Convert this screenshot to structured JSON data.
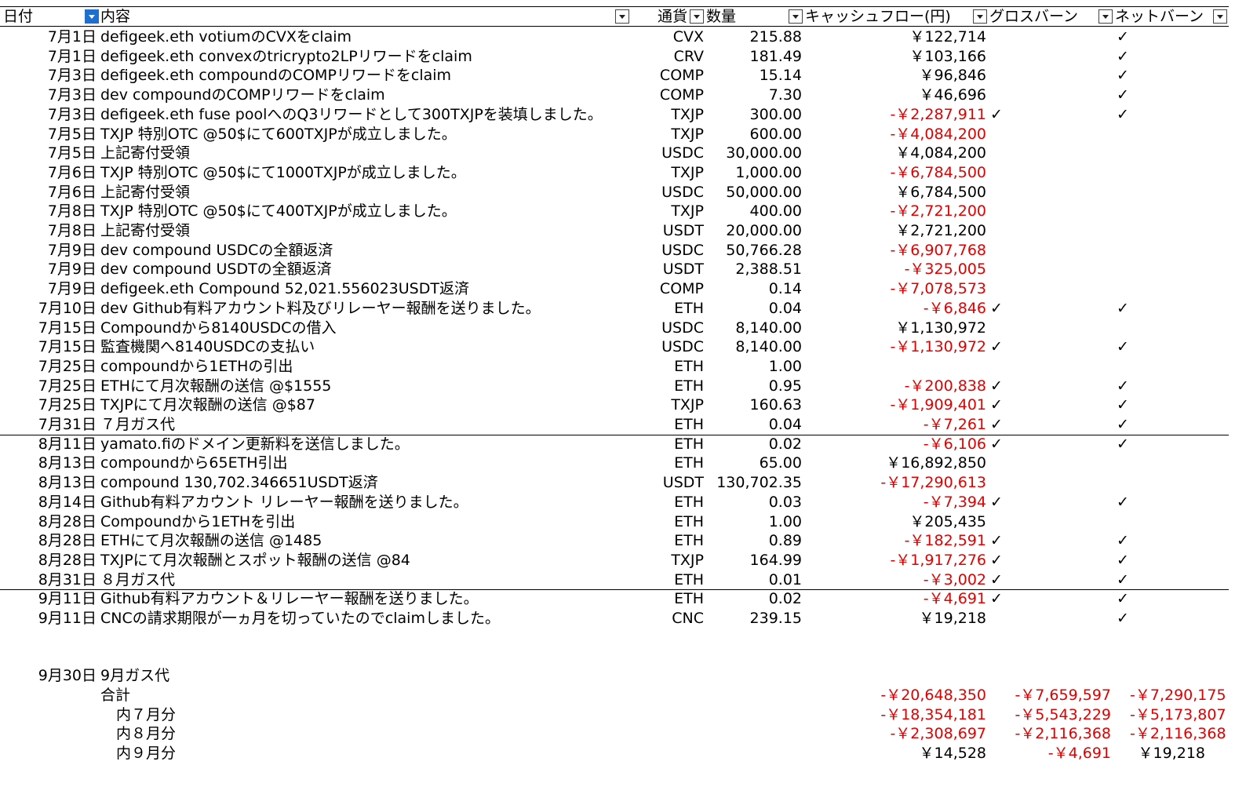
{
  "headers": {
    "date": "日付",
    "content": "内容",
    "currency": "通貨",
    "quantity": "数量",
    "cashflow": "キャッシュフロー(円)",
    "gross_burn": "グロスバーン",
    "net_burn": "ネットバーン"
  },
  "rows": [
    {
      "date": "7月1日",
      "desc": "defigeek.eth  votiumのCVXをclaim",
      "cur": "CVX",
      "qty": "215.88",
      "cf": "￥122,714",
      "neg": false,
      "gb": "",
      "nb": "✓"
    },
    {
      "date": "7月1日",
      "desc": "defigeek.eth  convexのtricrypto2LPリワードをclaim",
      "cur": "CRV",
      "qty": "181.49",
      "cf": "￥103,166",
      "neg": false,
      "gb": "",
      "nb": "✓"
    },
    {
      "date": "7月3日",
      "desc": "defigeek.eth   compoundのCOMPリワードをclaim",
      "cur": "COMP",
      "qty": "15.14",
      "cf": "￥96,846",
      "neg": false,
      "gb": "",
      "nb": "✓"
    },
    {
      "date": "7月3日",
      "desc": "dev   compoundのCOMPリワードをclaim",
      "cur": "COMP",
      "qty": "7.30",
      "cf": "￥46,696",
      "neg": false,
      "gb": "",
      "nb": "✓"
    },
    {
      "date": "7月3日",
      "desc": "defigeek.eth   fuse poolへのQ3リワードとして300TXJPを装填しました。",
      "cur": "TXJP",
      "qty": "300.00",
      "cf": "-￥2,287,911",
      "neg": true,
      "gb": "✓",
      "nb": "✓"
    },
    {
      "date": "7月5日",
      "desc": "TXJP 特別OTC    @50$にて600TXJPが成立しました。",
      "cur": "TXJP",
      "qty": "600.00",
      "cf": "-￥4,084,200",
      "neg": true,
      "gb": "",
      "nb": ""
    },
    {
      "date": "7月5日",
      "desc": "上記寄付受領",
      "cur": "USDC",
      "qty": "30,000.00",
      "cf": "￥4,084,200",
      "neg": false,
      "gb": "",
      "nb": ""
    },
    {
      "date": "7月6日",
      "desc": "TXJP 特別OTC    @50$にて1000TXJPが成立しました。",
      "cur": "TXJP",
      "qty": "1,000.00",
      "cf": "-￥6,784,500",
      "neg": true,
      "gb": "",
      "nb": ""
    },
    {
      "date": "7月6日",
      "desc": "上記寄付受領",
      "cur": "USDC",
      "qty": "50,000.00",
      "cf": "￥6,784,500",
      "neg": false,
      "gb": "",
      "nb": ""
    },
    {
      "date": "7月8日",
      "desc": "TXJP 特別OTC    @50$にて400TXJPが成立しました。",
      "cur": "TXJP",
      "qty": "400.00",
      "cf": "-￥2,721,200",
      "neg": true,
      "gb": "",
      "nb": ""
    },
    {
      "date": "7月8日",
      "desc": "上記寄付受領",
      "cur": "USDT",
      "qty": "20,000.00",
      "cf": "￥2,721,200",
      "neg": false,
      "gb": "",
      "nb": ""
    },
    {
      "date": "7月9日",
      "desc": "dev  compound   USDCの全額返済",
      "cur": "USDC",
      "qty": "50,766.28",
      "cf": "-￥6,907,768",
      "neg": true,
      "gb": "",
      "nb": ""
    },
    {
      "date": "7月9日",
      "desc": "dev  compound   USDTの全額返済",
      "cur": "USDT",
      "qty": "2,388.51",
      "cf": "-￥325,005",
      "neg": true,
      "gb": "",
      "nb": ""
    },
    {
      "date": "7月9日",
      "desc": "defigeek.eth  Compound   52,021.556023USDT返済",
      "cur": "COMP",
      "qty": "0.14",
      "cf": "-￥7,078,573",
      "neg": true,
      "gb": "",
      "nb": ""
    },
    {
      "date": "7月10日",
      "desc": "dev   Github有料アカウント料及びリレーヤー報酬を送りました。",
      "cur": "ETH",
      "qty": "0.04",
      "cf": "-￥6,846",
      "neg": true,
      "gb": "✓",
      "nb": "✓"
    },
    {
      "date": "7月15日",
      "desc": "Compoundから8140USDCの借入",
      "cur": "USDC",
      "qty": "8,140.00",
      "cf": "￥1,130,972",
      "neg": false,
      "gb": "",
      "nb": ""
    },
    {
      "date": "7月15日",
      "desc": "監査機関へ8140USDCの支払い",
      "cur": "USDC",
      "qty": "8,140.00",
      "cf": "-￥1,130,972",
      "neg": true,
      "gb": "✓",
      "nb": "✓"
    },
    {
      "date": "7月25日",
      "desc": "compoundから1ETHの引出",
      "cur": "ETH",
      "qty": "1.00",
      "cf": "",
      "neg": false,
      "gb": "",
      "nb": ""
    },
    {
      "date": "7月25日",
      "desc": "ETHにて月次報酬の送信    @$1555",
      "cur": "ETH",
      "qty": "0.95",
      "cf": "-￥200,838",
      "neg": true,
      "gb": "✓",
      "nb": "✓"
    },
    {
      "date": "7月25日",
      "desc": "TXJPにて月次報酬の送信    @$87",
      "cur": "TXJP",
      "qty": "160.63",
      "cf": "-￥1,909,401",
      "neg": true,
      "gb": "✓",
      "nb": "✓"
    },
    {
      "date": "7月31日",
      "desc": "７月ガス代",
      "cur": "ETH",
      "qty": "0.04",
      "cf": "-￥7,261",
      "neg": true,
      "gb": "✓",
      "nb": "✓",
      "sep": true
    },
    {
      "date": "8月11日",
      "desc": "yamato.fiのドメイン更新料を送信しました。",
      "cur": "ETH",
      "qty": "0.02",
      "cf": "-￥6,106",
      "neg": true,
      "gb": "✓",
      "nb": "✓"
    },
    {
      "date": "8月13日",
      "desc": "compoundから65ETH引出",
      "cur": "ETH",
      "qty": "65.00",
      "cf": "￥16,892,850",
      "neg": false,
      "gb": "",
      "nb": ""
    },
    {
      "date": "8月13日",
      "desc": "compound  130,702.346651USDT返済",
      "cur": "USDT",
      "qty": "130,702.35",
      "cf": "-￥17,290,613",
      "neg": true,
      "gb": "",
      "nb": ""
    },
    {
      "date": "8月14日",
      "desc": "Github有料アカウント    リレーヤー報酬を送りました。",
      "cur": "ETH",
      "qty": "0.03",
      "cf": "-￥7,394",
      "neg": true,
      "gb": "✓",
      "nb": "✓"
    },
    {
      "date": "8月28日",
      "desc": "Compoundから1ETHを引出",
      "cur": "ETH",
      "qty": "1.00",
      "cf": "￥205,435",
      "neg": false,
      "gb": "",
      "nb": ""
    },
    {
      "date": "8月28日",
      "desc": "ETHにて月次報酬の送信    @1485",
      "cur": "ETH",
      "qty": "0.89",
      "cf": "-￥182,591",
      "neg": true,
      "gb": "✓",
      "nb": "✓"
    },
    {
      "date": "8月28日",
      "desc": "TXJPにて月次報酬とスポット報酬の送信    @84",
      "cur": "TXJP",
      "qty": "164.99",
      "cf": "-￥1,917,276",
      "neg": true,
      "gb": "✓",
      "nb": "✓"
    },
    {
      "date": "8月31日",
      "desc": "８月ガス代",
      "cur": "ETH",
      "qty": "0.01",
      "cf": "-￥3,002",
      "neg": true,
      "gb": "✓",
      "nb": "✓",
      "sep": true
    },
    {
      "date": "9月11日",
      "desc": "Github有料アカウント＆リレーヤー報酬を送りました。",
      "cur": "ETH",
      "qty": "0.02",
      "cf": "-￥4,691",
      "neg": true,
      "gb": "✓",
      "nb": "✓"
    },
    {
      "date": "9月11日",
      "desc": "CNCの請求期限が一ヵ月を切っていたのでclaimしました。",
      "cur": "CNC",
      "qty": "239.15",
      "cf": "￥19,218",
      "neg": false,
      "gb": "",
      "nb": "✓"
    }
  ],
  "gas_row": {
    "date": "9月30日",
    "desc": "9月ガス代"
  },
  "totals": [
    {
      "label": "合計",
      "cf": "-￥20,648,350",
      "cf_neg": true,
      "gb": "-￥7,659,597",
      "gb_neg": true,
      "nb": "-￥7,290,175",
      "nb_neg": true
    },
    {
      "label": "内７月分",
      "cf": "-￥18,354,181",
      "cf_neg": true,
      "gb": "-￥5,543,229",
      "gb_neg": true,
      "nb": "-￥5,173,807",
      "nb_neg": true
    },
    {
      "label": "内８月分",
      "cf": "-￥2,308,697",
      "cf_neg": true,
      "gb": "-￥2,116,368",
      "gb_neg": true,
      "nb": "-￥2,116,368",
      "nb_neg": true
    },
    {
      "label": "内９月分",
      "cf": "￥14,528",
      "cf_neg": false,
      "gb": "-￥4,691",
      "gb_neg": true,
      "nb": "￥19,218",
      "nb_neg": false
    }
  ]
}
